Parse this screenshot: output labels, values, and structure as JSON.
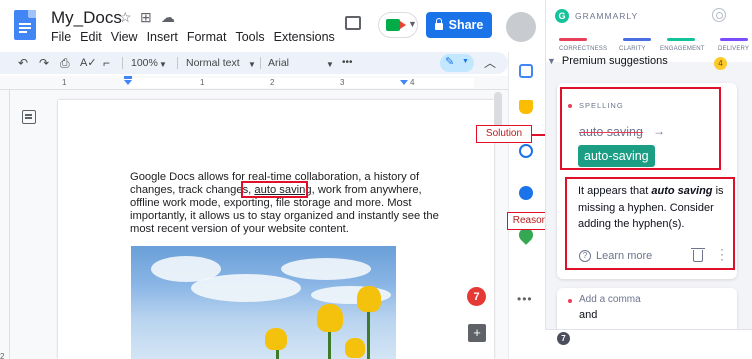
{
  "docs": {
    "title": "My_Docs",
    "menu": [
      "File",
      "Edit",
      "View",
      "Insert",
      "Format",
      "Tools",
      "Extensions"
    ],
    "share_label": "Share",
    "toolbar": {
      "zoom": "100%",
      "style": "Normal text",
      "font": "Arial",
      "more": "•••"
    },
    "ruler_numbers": [
      "1",
      "1",
      "2",
      "3",
      "4"
    ],
    "text_before": "Google Docs allows for real-time collaboration, a history of changes, track changes, ",
    "flagged_word": "auto saving",
    "text_after": ", work from anywhere, offline work mode, exporting, file storage and more. Most importantly, it allows us to stay organized and instantly see the most recent version of your website content.",
    "grammarly_badge": "7",
    "vertical_ruler_edge": "2"
  },
  "callouts": {
    "solution": "Solution",
    "reason": "Reason"
  },
  "grammarly": {
    "brand": "GRAMMARLY",
    "categories": [
      {
        "label": "CORRECTNESS",
        "color": "#e8405a"
      },
      {
        "label": "CLARITY",
        "color": "#4a6ee0"
      },
      {
        "label": "ENGAGEMENT",
        "color": "#15c39a"
      },
      {
        "label": "DELIVERY",
        "color": "#7c4dff"
      }
    ],
    "premium": "Premium suggestions",
    "premium_count": "4",
    "card": {
      "kind": "SPELLING",
      "original": "auto saving",
      "arrow": "→",
      "replacement": "auto-saving",
      "explanation_pre": "It appears that ",
      "explanation_word": "auto saving",
      "explanation_post": " is missing a hyphen. Consider adding the hyphen(s).",
      "learn_more": "Learn more"
    },
    "card2": {
      "title": "Add a comma",
      "word": "and"
    },
    "footer_badge": "7"
  },
  "colors": {
    "annotation_red": "#e0102a",
    "share_blue": "#1a73e8",
    "grammarly_green": "#1c9e85"
  }
}
